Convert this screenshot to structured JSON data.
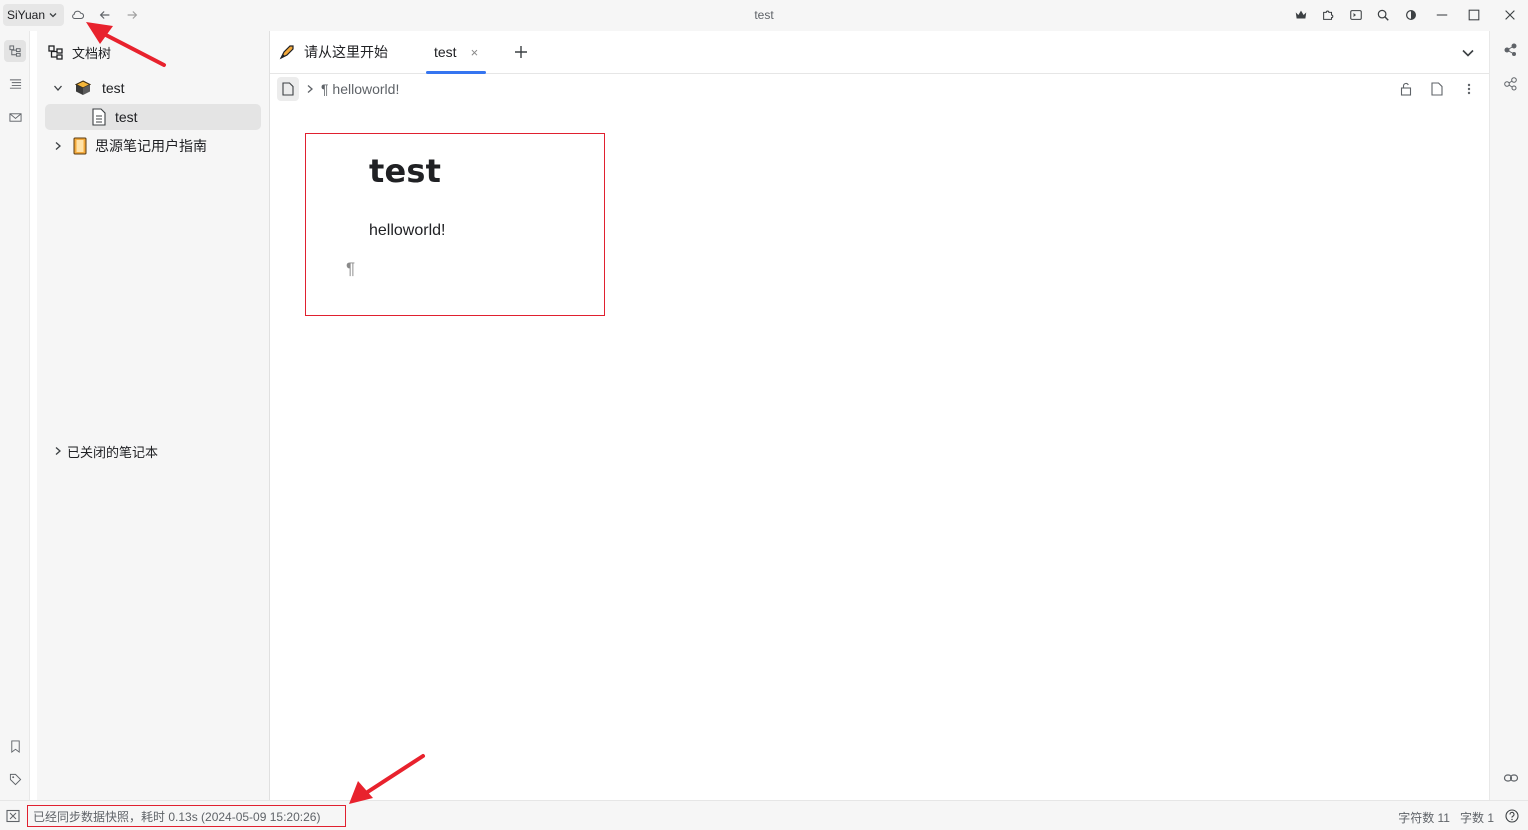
{
  "window": {
    "title": "test",
    "workspace": "SiYuan"
  },
  "toolbar_icons": [
    "sync-cloud-icon",
    "back-arrow-icon",
    "forward-arrow-icon",
    "crown-icon",
    "plugin-icon",
    "terminal-icon",
    "search-icon",
    "theme-icon",
    "minimize-icon",
    "maximize-icon",
    "close-icon"
  ],
  "sidebar": {
    "title": "文档树",
    "notebooks": [
      {
        "name": "test",
        "expanded": true,
        "docs": [
          {
            "name": "test",
            "selected": true
          }
        ]
      },
      {
        "name": "思源笔记用户指南",
        "expanded": false
      }
    ],
    "closed_notebooks": "已关闭的笔记本"
  },
  "tabs": [
    {
      "label": "请从这里开始",
      "active": false
    },
    {
      "label": "test",
      "active": true,
      "close": "×"
    }
  ],
  "breadcrumb": {
    "block": "¶ helloworld!"
  },
  "document": {
    "title": "test",
    "paragraph": "helloworld!",
    "empty_block_marker": "¶"
  },
  "status": {
    "message": "已经同步数据快照，耗时 0.13s (2024-05-09 15:20:26)",
    "chars": "字符数 11",
    "words": "字数 1"
  },
  "colors": {
    "accent": "#3575f0",
    "highlight": "#e0202f"
  }
}
